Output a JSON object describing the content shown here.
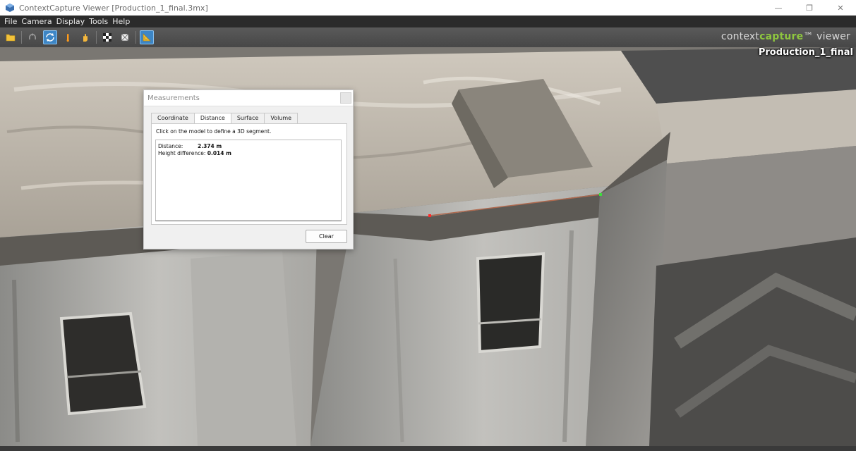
{
  "window": {
    "title": "ContextCapture Viewer [Production_1_final.3mx]",
    "controls": [
      "minimize",
      "restore",
      "close"
    ]
  },
  "menu": [
    "File",
    "Camera",
    "Display",
    "Tools",
    "Help"
  ],
  "toolbar": {
    "icons": [
      "open-folder-icon",
      "orbit-icon",
      "rotate-icon",
      "light-icon",
      "pan-icon",
      "texture-icon",
      "wireframe-icon",
      "measure-icon"
    ],
    "brand_prefix": "context",
    "brand_highlight": "capture",
    "brand_suffix": "™ viewer"
  },
  "viewport": {
    "production_label": "Production_1_final",
    "measure_start_color": "#ff2a2a",
    "measure_end_color": "#3ddc3d",
    "measure_line_color": "#b06a4f"
  },
  "dialog": {
    "title": "Measurements",
    "tabs": [
      "Coordinate",
      "Distance",
      "Surface",
      "Volume"
    ],
    "active_tab": "Distance",
    "hint": "Click on the model to define a 3D segment.",
    "distance_label": "Distance:",
    "distance_value": "2.374 m",
    "height_label": "Height difference:",
    "height_value": "0.014 m",
    "clear_label": "Clear"
  },
  "colors": {
    "brand_green": "#8ec63f",
    "active_tool": "#3d86c6"
  }
}
